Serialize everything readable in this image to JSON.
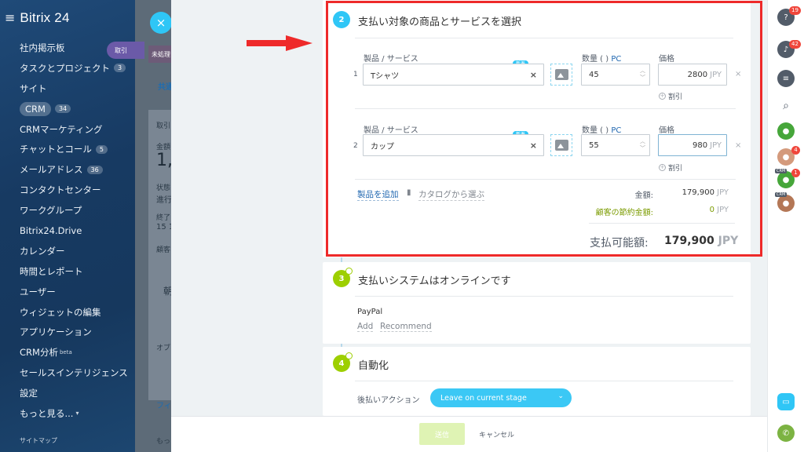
{
  "app": {
    "logo": "Bitrix 24"
  },
  "sidebar": {
    "items": [
      {
        "label": "社内掲示板"
      },
      {
        "label": "タスクとプロジェクト",
        "count": "3"
      },
      {
        "label": "サイト"
      },
      {
        "label": "CRM",
        "count": "34"
      },
      {
        "label": "CRMマーケティング"
      },
      {
        "label": "チャットとコール",
        "count": "5"
      },
      {
        "label": "メールアドレス",
        "count": "36"
      },
      {
        "label": "コンタクトセンター"
      },
      {
        "label": "ワークグループ"
      },
      {
        "label": "Bitrix24.Drive"
      },
      {
        "label": "カレンダー"
      },
      {
        "label": "時間とレポート"
      },
      {
        "label": "ユーザー"
      },
      {
        "label": "ウィジェットの編集"
      },
      {
        "label": "アプリケーション"
      },
      {
        "label": "CRM分析",
        "sup": "beta"
      },
      {
        "label": "セールスインテリジェンス"
      },
      {
        "label": "設定"
      },
      {
        "label": "もっと見る..."
      }
    ],
    "sitemap": "サイトマップ",
    "deal_pill": "取引"
  },
  "background": {
    "badge": "未処理",
    "tab": "共通",
    "frag1": "取引",
    "frag2": "金額",
    "amount": "1,",
    "frag3": "状態",
    "frag4": "進行",
    "frag5": "終了",
    "frag6": "15 1",
    "frag7": "顧客",
    "frag8": "朝",
    "frag9": "オブ",
    "frag10": "フィ",
    "frag11": "もっと"
  },
  "step2": {
    "number": "2",
    "title": "支払い対象の商品とサービスを選択",
    "product_label": "製品 / サービス",
    "qty_label": "数量 ( )",
    "qty_unit": "PC",
    "price_label": "価格",
    "new_badge": "新着",
    "discount": "割引",
    "rows": [
      {
        "index": "1",
        "name": "Tシャツ",
        "qty": "45",
        "price": "2800",
        "currency": "JPY"
      },
      {
        "index": "2",
        "name": "カップ",
        "qty": "55",
        "price": "980",
        "currency": "JPY"
      }
    ],
    "add_product": "製品を追加",
    "catalog": "カタログから選ぶ",
    "amount_label": "金額:",
    "amount_value": "179,900",
    "amount_currency": "JPY",
    "saving_label": "顧客の節約金額:",
    "saving_value": "0",
    "saving_currency": "JPY",
    "total_label": "支払可能額:",
    "total_value": "179,900",
    "total_currency": "JPY"
  },
  "step3": {
    "number": "3",
    "title": "支払いシステムはオンラインです",
    "system": "PayPal",
    "add": "Add",
    "recommend": "Recommend"
  },
  "step4": {
    "number": "4",
    "title": "自動化",
    "action_label": "後払いアクション",
    "action_value": "Leave on current stage"
  },
  "footer": {
    "send": "送信",
    "cancel": "キャンセル"
  },
  "rightbar": {
    "help_badge": "19",
    "bell_badge": "42",
    "ava2_badge": "4",
    "ava3_badge": "1",
    "crm_tag": "CRM"
  },
  "colors": {
    "accent": "#2fc6f6",
    "green": "#9dcf00",
    "highlight": "#ee2a2a",
    "link": "#2067b0"
  }
}
